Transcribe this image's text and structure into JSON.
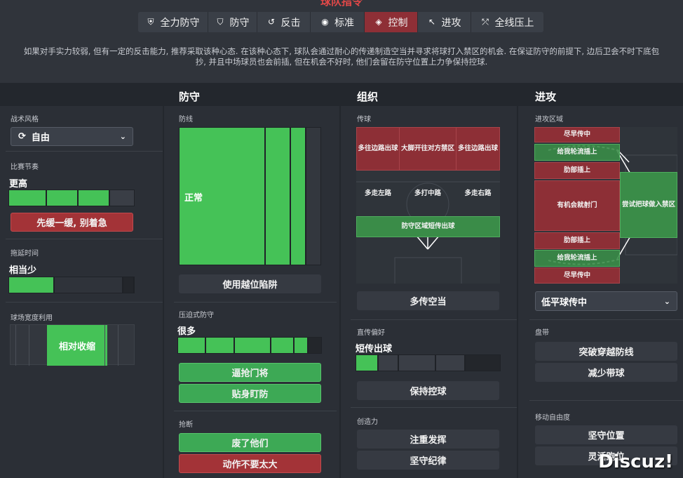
{
  "header": {
    "title": "球队指令",
    "mentalities": [
      {
        "label": "全力防守",
        "icon": "shield-double-icon",
        "selected": false
      },
      {
        "label": "防守",
        "icon": "shield-icon",
        "selected": false
      },
      {
        "label": "反击",
        "icon": "counter-icon",
        "selected": false
      },
      {
        "label": "标准",
        "icon": "balanced-icon",
        "selected": false
      },
      {
        "label": "控制",
        "icon": "cube-icon",
        "selected": true
      },
      {
        "label": "进攻",
        "icon": "attack-arrow-icon",
        "selected": false
      },
      {
        "label": "全线压上",
        "icon": "all-out-icon",
        "selected": false
      }
    ],
    "description_line1": "如果对手实力较弱, 但有一定的反击能力, 推荐采取该种心态. 在该种心态下, 球队会通过耐心的传递制造空当并寻求将球打入禁区的机会. 在保证防守的前提下, 边后卫会不时下底包",
    "description_line2": "抄, 并且中场球员也会前插, 但在机会不好时, 他们会留在防守位置上力争保持控球."
  },
  "general": {
    "style_label": "战术风格",
    "style_value": "自由",
    "tempo_label": "比赛节奏",
    "tempo_value": "更高",
    "tempo_level": 0.72,
    "tempo_button": "先缓一缓, 别着急",
    "time_wasting_label": "拖延时间",
    "time_wasting_value": "相当少",
    "time_wasting_level": 0.35,
    "width_label": "球场宽度利用",
    "width_value": "相对收缩"
  },
  "defence": {
    "title": "防守",
    "line_label": "防线",
    "line_value": "正常",
    "offside_button": "使用越位陷阱",
    "press_label": "压迫式防守",
    "press_value": "很多",
    "press_level": 0.88,
    "press_buttons": [
      "逼抢门将",
      "贴身盯防"
    ],
    "tackle_label": "抢断",
    "tackle_buttons": [
      "废了他们",
      "动作不要太大"
    ]
  },
  "organisation": {
    "title": "组织",
    "passing_label": "传球",
    "passing_zones": {
      "top_left": "多往边路出球",
      "top_mid": "大脚开往对方禁区",
      "top_right": "多往边路出球",
      "mid_left": "多走左路",
      "mid_mid": "多打中路",
      "mid_right": "多走右路",
      "build_up": "防守区域短传出球"
    },
    "space_button": "多传空当",
    "directness_label": "直传偏好",
    "directness_value": "短传出球",
    "directness_level": 0.2,
    "possession_button": "保持控球",
    "creativity_label": "创造力",
    "creativity_buttons": [
      "注重发挥",
      "坚守纪律"
    ]
  },
  "attack": {
    "title": "进攻",
    "zones_label": "进攻区域",
    "zones": {
      "cross_early_top": "尽早传中",
      "overlap_top": "给我轮流插上",
      "byline_top": "肋部插上",
      "shoot": "有机会就射门",
      "into_box": "尝试把球做入禁区",
      "byline_bottom": "肋部插上",
      "overlap_bottom": "给我轮流插上",
      "cross_early_bottom": "尽早传中"
    },
    "cross_dropdown": "低平球传中",
    "dribble_label": "盘带",
    "dribble_buttons": [
      "突破穿越防线",
      "减少带球"
    ],
    "freedom_label": "移动自由度",
    "freedom_buttons": [
      "坚守位置",
      "灵活跑位"
    ]
  },
  "watermark": "Discuz!"
}
